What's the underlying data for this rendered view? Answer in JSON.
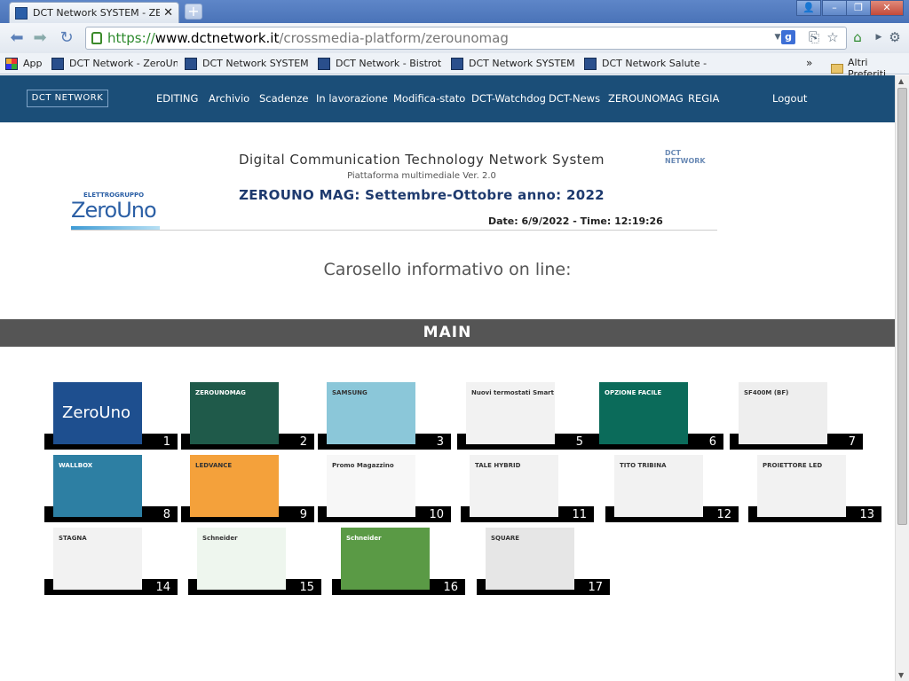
{
  "browser": {
    "tab_title": "DCT Network SYSTEM - ZEROUNO",
    "url_scheme": "https://",
    "url_host": "www.dctnetwork.it",
    "url_path": "/crossmedia-platform/zerounomag",
    "bookmarks": [
      {
        "label": "App"
      },
      {
        "label": "DCT Network - ZeroUno"
      },
      {
        "label": "DCT Network SYSTEM - ..."
      },
      {
        "label": "DCT Network - Bistrot lo..."
      },
      {
        "label": "DCT Network SYSTEM - ..."
      },
      {
        "label": "DCT Network Salute - lo..."
      }
    ],
    "bookmarks_overflow": "»",
    "other_bookmarks": "Altri Preferiti"
  },
  "nav": {
    "brand": "DCT NETWORK",
    "items": [
      "EDITING",
      "Archivio",
      "Scadenze",
      "In lavorazione",
      "Modifica-stato",
      "DCT-Watchdog",
      "DCT-News",
      "ZEROUNOMAG",
      "REGIA"
    ],
    "logout": "Logout"
  },
  "header": {
    "title": "Digital Communication Technology Network System",
    "subtitle": "Piattaforma multimediale Ver. 2.0",
    "headline": "ZEROUNO MAG: Settembre-Ottobre anno: 2022",
    "datetime": "Date: 6/9/2022 - Time: 12:19:26",
    "logo_left_top": "ELETTROGRUPPO",
    "logo_left_big": "ZeroUno",
    "logo_right": "DCT NETWORK"
  },
  "carousel_title": "Carosello informativo on line:",
  "section_title": "MAIN",
  "tiles": [
    {
      "num": "1",
      "bg": "#1e4f8f",
      "label": "ZeroUno"
    },
    {
      "num": "2",
      "bg": "#1f5a4a",
      "label": "ZEROUNOMAG"
    },
    {
      "num": "3",
      "bg": "#8bc7d9",
      "label": "SAMSUNG"
    },
    {
      "num": "5",
      "bg": "#f2f2f2",
      "label": "Nuovi termostati Smart"
    },
    {
      "num": "6",
      "bg": "#0b6b5a",
      "label": "OPZIONE FACILE"
    },
    {
      "num": "7",
      "bg": "#eeeeee",
      "label": "SF400M (BF)"
    },
    {
      "num": "8",
      "bg": "#2d7fa3",
      "label": "WALLBOX"
    },
    {
      "num": "9",
      "bg": "#f4a13b",
      "label": "LEDVANCE"
    },
    {
      "num": "10",
      "bg": "#f7f7f7",
      "label": "Promo Magazzino"
    },
    {
      "num": "11",
      "bg": "#f2f2f2",
      "label": "TALE HYBRID"
    },
    {
      "num": "12",
      "bg": "#f2f2f2",
      "label": "TITO TRIBINA"
    },
    {
      "num": "13",
      "bg": "#f2f2f2",
      "label": "PROIETTORE LED"
    },
    {
      "num": "14",
      "bg": "#f2f2f2",
      "label": "STAGNA"
    },
    {
      "num": "15",
      "bg": "#eef6ee",
      "label": "Schneider"
    },
    {
      "num": "16",
      "bg": "#5a9a45",
      "label": "Schneider"
    },
    {
      "num": "17",
      "bg": "#e6e6e6",
      "label": "SQUARE"
    }
  ],
  "colors": {
    "nav_bg": "#1b4e78",
    "section_bar": "#555555",
    "headline": "#1e3a6e"
  }
}
